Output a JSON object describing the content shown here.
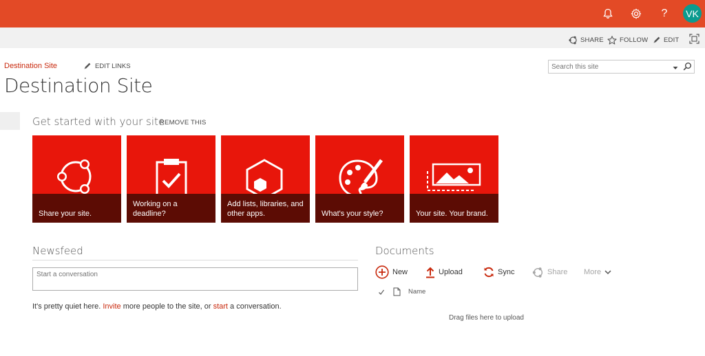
{
  "suitebar": {
    "icons": [
      "bell-icon",
      "gear-icon",
      "help-icon"
    ],
    "help_glyph": "?",
    "avatar_initials": "VK",
    "color": "#e34a26"
  },
  "ribbon": {
    "share_label": "SHARE",
    "follow_label": "FOLLOW",
    "edit_label": "EDIT"
  },
  "nav": {
    "site_link": "Destination Site",
    "edit_links_label": "EDIT LINKS"
  },
  "page": {
    "title": "Destination Site"
  },
  "search": {
    "placeholder": "Search this site"
  },
  "get_started": {
    "title": "Get started with your site",
    "remove_label": "REMOVE THIS",
    "tiles": [
      {
        "label_line1": "Share your site.",
        "label_line2": "",
        "icon": "share-icon"
      },
      {
        "label_line1": "Working on a",
        "label_line2": "deadline?",
        "icon": "clipboard-check-icon"
      },
      {
        "label_line1": "Add lists, libraries, and",
        "label_line2": "other apps.",
        "icon": "apps-hexagon-icon"
      },
      {
        "label_line1": "What's your style?",
        "label_line2": "",
        "icon": "palette-icon"
      },
      {
        "label_line1": "Your site. Your brand.",
        "label_line2": "",
        "icon": "brand-image-icon"
      }
    ],
    "tile_color": "#e8160b",
    "band_color": "#5c0c04"
  },
  "newsfeed": {
    "title": "Newsfeed",
    "input_placeholder": "Start a conversation",
    "quiet_prefix": "It's pretty quiet here. ",
    "invite_link": "Invite",
    "quiet_middle": " more people to the site, or ",
    "start_link": "start",
    "quiet_suffix": " a conversation."
  },
  "documents": {
    "title": "Documents",
    "commands": {
      "new": "New",
      "upload": "Upload",
      "sync": "Sync",
      "share": "Share",
      "more": "More"
    },
    "column_name": "Name",
    "drag_message": "Drag files here to upload"
  },
  "colors": {
    "accent": "#c8280c",
    "link": "#c8280c"
  }
}
